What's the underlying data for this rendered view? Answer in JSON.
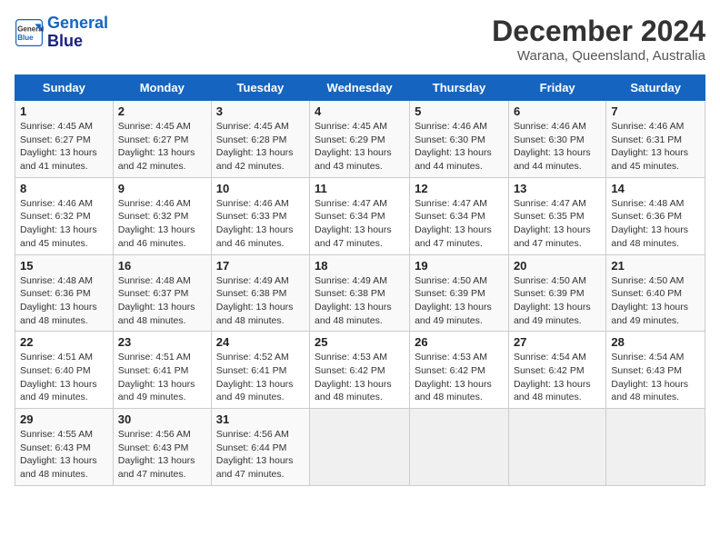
{
  "header": {
    "logo_line1": "General",
    "logo_line2": "Blue",
    "month": "December 2024",
    "location": "Warana, Queensland, Australia"
  },
  "weekdays": [
    "Sunday",
    "Monday",
    "Tuesday",
    "Wednesday",
    "Thursday",
    "Friday",
    "Saturday"
  ],
  "weeks": [
    [
      {
        "day": "1",
        "info": "Sunrise: 4:45 AM\nSunset: 6:27 PM\nDaylight: 13 hours\nand 41 minutes."
      },
      {
        "day": "2",
        "info": "Sunrise: 4:45 AM\nSunset: 6:27 PM\nDaylight: 13 hours\nand 42 minutes."
      },
      {
        "day": "3",
        "info": "Sunrise: 4:45 AM\nSunset: 6:28 PM\nDaylight: 13 hours\nand 42 minutes."
      },
      {
        "day": "4",
        "info": "Sunrise: 4:45 AM\nSunset: 6:29 PM\nDaylight: 13 hours\nand 43 minutes."
      },
      {
        "day": "5",
        "info": "Sunrise: 4:46 AM\nSunset: 6:30 PM\nDaylight: 13 hours\nand 44 minutes."
      },
      {
        "day": "6",
        "info": "Sunrise: 4:46 AM\nSunset: 6:30 PM\nDaylight: 13 hours\nand 44 minutes."
      },
      {
        "day": "7",
        "info": "Sunrise: 4:46 AM\nSunset: 6:31 PM\nDaylight: 13 hours\nand 45 minutes."
      }
    ],
    [
      {
        "day": "8",
        "info": "Sunrise: 4:46 AM\nSunset: 6:32 PM\nDaylight: 13 hours\nand 45 minutes."
      },
      {
        "day": "9",
        "info": "Sunrise: 4:46 AM\nSunset: 6:32 PM\nDaylight: 13 hours\nand 46 minutes."
      },
      {
        "day": "10",
        "info": "Sunrise: 4:46 AM\nSunset: 6:33 PM\nDaylight: 13 hours\nand 46 minutes."
      },
      {
        "day": "11",
        "info": "Sunrise: 4:47 AM\nSunset: 6:34 PM\nDaylight: 13 hours\nand 47 minutes."
      },
      {
        "day": "12",
        "info": "Sunrise: 4:47 AM\nSunset: 6:34 PM\nDaylight: 13 hours\nand 47 minutes."
      },
      {
        "day": "13",
        "info": "Sunrise: 4:47 AM\nSunset: 6:35 PM\nDaylight: 13 hours\nand 47 minutes."
      },
      {
        "day": "14",
        "info": "Sunrise: 4:48 AM\nSunset: 6:36 PM\nDaylight: 13 hours\nand 48 minutes."
      }
    ],
    [
      {
        "day": "15",
        "info": "Sunrise: 4:48 AM\nSunset: 6:36 PM\nDaylight: 13 hours\nand 48 minutes."
      },
      {
        "day": "16",
        "info": "Sunrise: 4:48 AM\nSunset: 6:37 PM\nDaylight: 13 hours\nand 48 minutes."
      },
      {
        "day": "17",
        "info": "Sunrise: 4:49 AM\nSunset: 6:38 PM\nDaylight: 13 hours\nand 48 minutes."
      },
      {
        "day": "18",
        "info": "Sunrise: 4:49 AM\nSunset: 6:38 PM\nDaylight: 13 hours\nand 48 minutes."
      },
      {
        "day": "19",
        "info": "Sunrise: 4:50 AM\nSunset: 6:39 PM\nDaylight: 13 hours\nand 49 minutes."
      },
      {
        "day": "20",
        "info": "Sunrise: 4:50 AM\nSunset: 6:39 PM\nDaylight: 13 hours\nand 49 minutes."
      },
      {
        "day": "21",
        "info": "Sunrise: 4:50 AM\nSunset: 6:40 PM\nDaylight: 13 hours\nand 49 minutes."
      }
    ],
    [
      {
        "day": "22",
        "info": "Sunrise: 4:51 AM\nSunset: 6:40 PM\nDaylight: 13 hours\nand 49 minutes."
      },
      {
        "day": "23",
        "info": "Sunrise: 4:51 AM\nSunset: 6:41 PM\nDaylight: 13 hours\nand 49 minutes."
      },
      {
        "day": "24",
        "info": "Sunrise: 4:52 AM\nSunset: 6:41 PM\nDaylight: 13 hours\nand 49 minutes."
      },
      {
        "day": "25",
        "info": "Sunrise: 4:53 AM\nSunset: 6:42 PM\nDaylight: 13 hours\nand 48 minutes."
      },
      {
        "day": "26",
        "info": "Sunrise: 4:53 AM\nSunset: 6:42 PM\nDaylight: 13 hours\nand 48 minutes."
      },
      {
        "day": "27",
        "info": "Sunrise: 4:54 AM\nSunset: 6:42 PM\nDaylight: 13 hours\nand 48 minutes."
      },
      {
        "day": "28",
        "info": "Sunrise: 4:54 AM\nSunset: 6:43 PM\nDaylight: 13 hours\nand 48 minutes."
      }
    ],
    [
      {
        "day": "29",
        "info": "Sunrise: 4:55 AM\nSunset: 6:43 PM\nDaylight: 13 hours\nand 48 minutes."
      },
      {
        "day": "30",
        "info": "Sunrise: 4:56 AM\nSunset: 6:43 PM\nDaylight: 13 hours\nand 47 minutes."
      },
      {
        "day": "31",
        "info": "Sunrise: 4:56 AM\nSunset: 6:44 PM\nDaylight: 13 hours\nand 47 minutes."
      },
      null,
      null,
      null,
      null
    ]
  ]
}
